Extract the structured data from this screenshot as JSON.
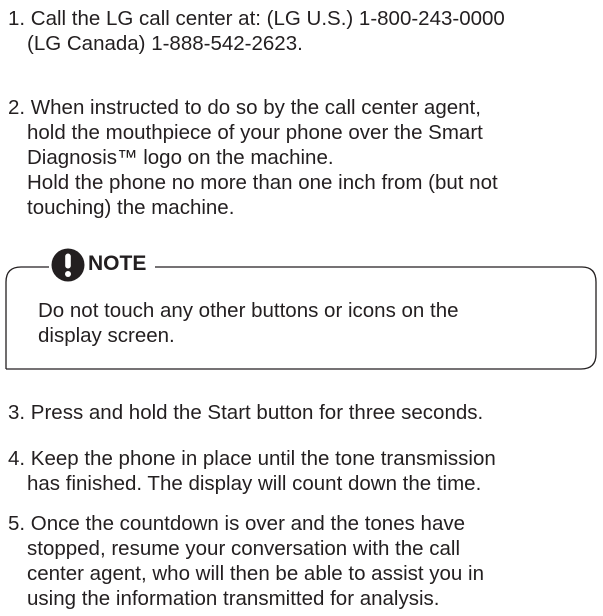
{
  "steps": [
    {
      "lines": [
        "1. Call the LG call center at: (LG U.S.) 1-800-243-0000",
        "(LG Canada) 1-888-542-2623."
      ]
    },
    {
      "lines": [
        "2. When instructed to do so by the call center agent,",
        "hold the mouthpiece of your phone over the Smart",
        "Diagnosis™ logo on the machine.",
        "Hold the phone no more than one inch from (but not",
        "touching) the machine."
      ]
    },
    {
      "lines": [
        "3. Press and hold the Start button for three seconds."
      ]
    },
    {
      "lines": [
        "4. Keep the phone in place until the tone transmission",
        "has finished. The display will count down the time."
      ]
    },
    {
      "lines": [
        "5. Once the countdown is over and the tones have",
        "stopped, resume your conversation with the call",
        "center agent, who will then be able to assist you in",
        "using the information transmitted for analysis."
      ]
    }
  ],
  "note": {
    "icon": "exclamation-icon",
    "title": "NOTE",
    "lines": [
      "Do not touch any other buttons or icons on the",
      "display screen."
    ]
  },
  "colors": {
    "text": "#231f20",
    "icon": "#231f20",
    "border": "#231f20"
  }
}
